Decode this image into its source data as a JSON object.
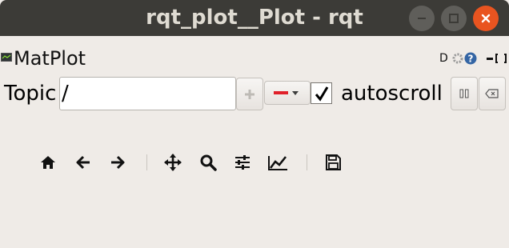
{
  "window": {
    "title": "rqt_plot__Plot - rqt"
  },
  "dock": {
    "title": "MatPlot",
    "tools": [
      "D",
      "options-icon",
      "help-icon",
      "minimize-icon",
      "float-icon"
    ],
    "tool_d_label": "D"
  },
  "topic_row": {
    "label": "Topic",
    "input_value": "/",
    "add_icon": "plus-icon",
    "color_swatch": "#e0202a",
    "autoscroll_checked": true,
    "autoscroll_label": "autoscroll",
    "pause_icon": "pause-icon",
    "clear_icon": "clear-icon"
  },
  "toolbar": {
    "items": [
      "home-icon",
      "back-icon",
      "forward-icon",
      "pan-icon",
      "zoom-icon",
      "subplots-icon",
      "customize-icon",
      "save-icon"
    ]
  },
  "colors": {
    "titlebar": "#3c3b37",
    "close_button": "#e95420",
    "background": "#efebe7"
  }
}
